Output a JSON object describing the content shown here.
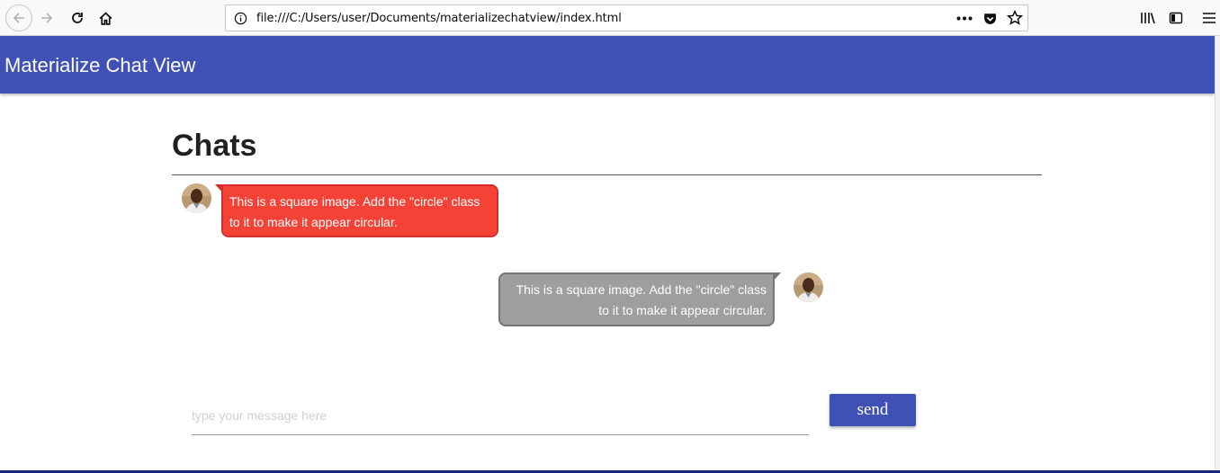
{
  "browser": {
    "url": "file:///C:/Users/user/Documents/materializechatview/index.html"
  },
  "navbar": {
    "title": "Materialize Chat View",
    "color": "#3f51b5"
  },
  "chat": {
    "heading": "Chats",
    "messages": [
      {
        "side": "left",
        "color": "#f44336",
        "text_line1": "This is a square image. Add the \"circle\" class",
        "text_line2": "to it to make it appear circular."
      },
      {
        "side": "right",
        "color": "#9e9e9e",
        "text_line1": "This is a square image. Add the \"circle\" class",
        "text_line2": "to it to make it appear circular."
      }
    ]
  },
  "composer": {
    "placeholder": "type your message here",
    "send_label": "send"
  }
}
